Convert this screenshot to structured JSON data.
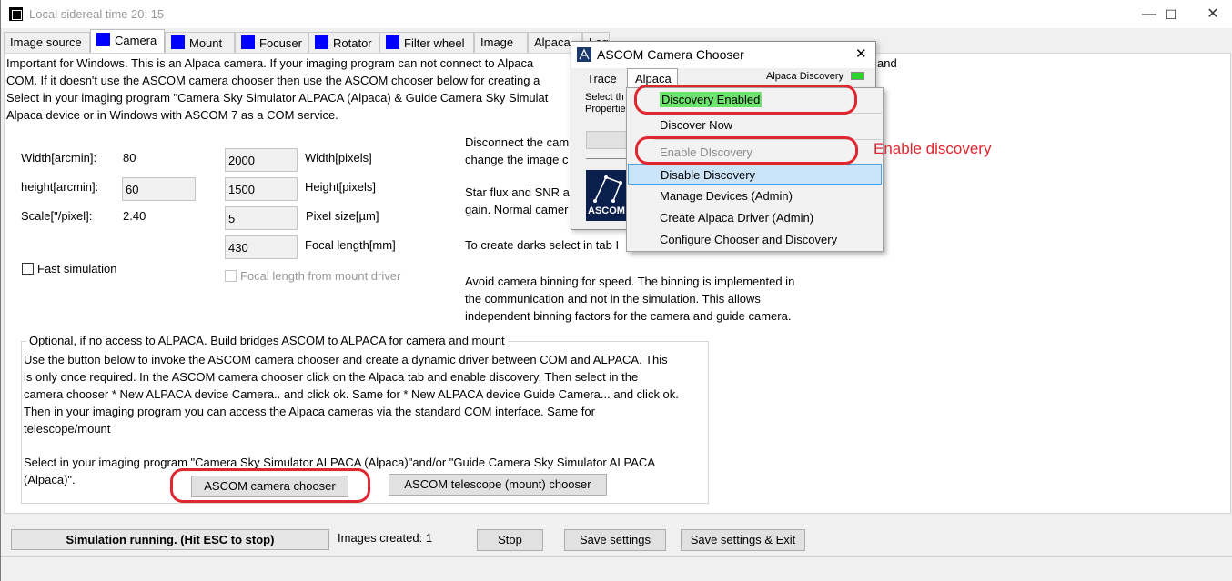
{
  "window": {
    "title": "Local sidereal time 20: 15",
    "minimize": "—",
    "maximize": "☐",
    "close": "✕"
  },
  "tabs": [
    "Image source",
    "Camera",
    "Mount",
    "Focuser",
    "Rotator",
    "Filter wheel",
    "Image",
    "Alpaca",
    "Log"
  ],
  "intro": {
    "line1": "Important for Windows. This is an Alpaca camera. If your imaging program can not connect to Alpaca",
    "line1_tail": "and",
    "line2": "COM.  If it doesn't use the ASCOM camera chooser then use the ASCOM chooser below for creating a",
    "line3": "Select in your imaging program \"Camera Sky Simulator ALPACA (Alpaca) & Guide Camera Sky Simulat",
    "line4": "Alpaca device or in Windows with ASCOM 7 as a COM service."
  },
  "fields": {
    "width_arcmin_label": "Width[arcmin]:",
    "width_arcmin_value": "80",
    "height_arcmin_label": "height[arcmin]:",
    "height_arcmin_value": "60",
    "scale_label": "Scale[\"/pixel]:",
    "scale_value": "2.40",
    "width_px_value": "2000",
    "width_px_label": "Width[pixels]",
    "height_px_value": "1500",
    "height_px_label": "Height[pixels]",
    "pixel_size_value": "5",
    "pixel_size_label": "Pixel size[µm]",
    "focal_value": "430",
    "focal_label": "Focal length[mm]",
    "fast_sim": "Fast simulation",
    "focal_from_mount": "Focal length from mount driver"
  },
  "notes": {
    "n1a": "Disconnect the cam",
    "n1b": "change the image c",
    "n2a": "Star flux  and SNR a",
    "n2b": "gain. Normal camer",
    "n3": "To create darks select in tab I",
    "n4a": "Avoid camera binning for speed. The binning is implemented in",
    "n4b": "the communication and not in the simulation. This allows",
    "n4c": "independent binning factors for the camera and guide camera."
  },
  "group": {
    "title": "Optional, if no access to ALPACA. Build bridges ASCOM to ALPACA for camera and mount",
    "p1": "Use the button below to invoke the ASCOM camera chooser and create a dynamic driver between COM and ALPACA. This",
    "p2": "is only once required. In the ASCOM camera chooser click on the Alpaca tab and enable discovery. Then select in the",
    "p3": "camera chooser * New ALPACA device Camera.. and click ok. Same for  * New ALPACA device Guide Camera... and click ok.",
    "p4": "Then in your imaging program you can access the Alpaca cameras via the standard  COM interface.  Same for",
    "p5": "telescope/mount",
    "p6": "Select in your imaging program \"Camera Sky Simulator ALPACA (Alpaca)\"and/or \"Guide Camera Sky Simulator ALPACA",
    "p7": "(Alpaca)\".",
    "btn_camera": "ASCOM camera chooser",
    "btn_telescope": "ASCOM telescope (mount) chooser"
  },
  "status": {
    "running": "Simulation running. (Hit ESC to stop)",
    "images": "Images created: 1",
    "stop": "Stop",
    "save": "Save settings",
    "save_exit": "Save settings & Exit"
  },
  "dialog": {
    "title": "ASCOM Camera Chooser",
    "close": "✕",
    "menu_trace": "Trace",
    "menu_alpaca": "Alpaca",
    "discovery_label": "Alpaca Discovery",
    "select_line1": "Select th",
    "select_line2": "Properties",
    "logo_text": "ASCOM"
  },
  "menu": {
    "items": [
      "Discovery Enabled",
      "Discover Now",
      "Enable DIscovery",
      "Disable Discovery",
      "Manage Devices (Admin)",
      "Create Alpaca Driver (Admin)",
      "Configure Chooser and Discovery"
    ]
  },
  "annotation": {
    "label": "Enable discovery"
  },
  "colors": {
    "accent_red": "#e0262e",
    "discovery_green": "#2bd32b",
    "highlight_blue": "#cce4f7",
    "tab_square": "#0000ff"
  }
}
